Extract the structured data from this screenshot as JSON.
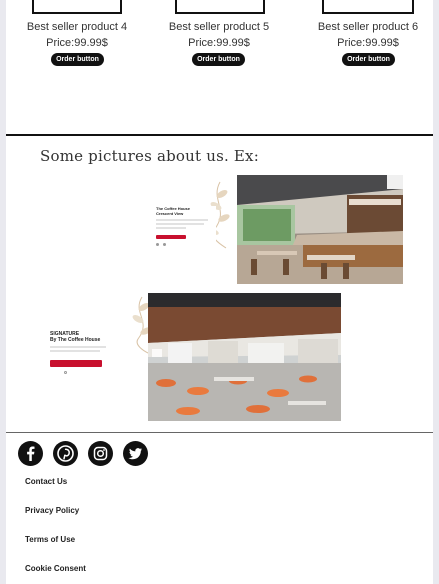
{
  "products": [
    {
      "name": "Best seller product 4",
      "price": "Price:99.99$",
      "button": "Order button"
    },
    {
      "name": "Best seller product 5",
      "price": "Price:99.99$",
      "button": "Order button"
    },
    {
      "name": "Best seller product 6",
      "price": "Price:99.99$",
      "button": "Order button"
    }
  ],
  "gallery": {
    "title": "Some pictures about us. Ex:",
    "slide1": {
      "heading": "The Coffee House",
      "subheading": "Crescent View"
    },
    "slide2": {
      "heading": "SIGNATURE",
      "subheading": "By The Coffee House"
    }
  },
  "footer": {
    "social": [
      "facebook-icon",
      "pinterest-icon",
      "instagram-icon",
      "twitter-icon"
    ],
    "links": [
      "Contact Us",
      "Privacy Policy",
      "Terms of Use",
      "Cookie Consent"
    ]
  },
  "colors": {
    "accent_red": "#c8102e",
    "button_black": "#111111"
  }
}
